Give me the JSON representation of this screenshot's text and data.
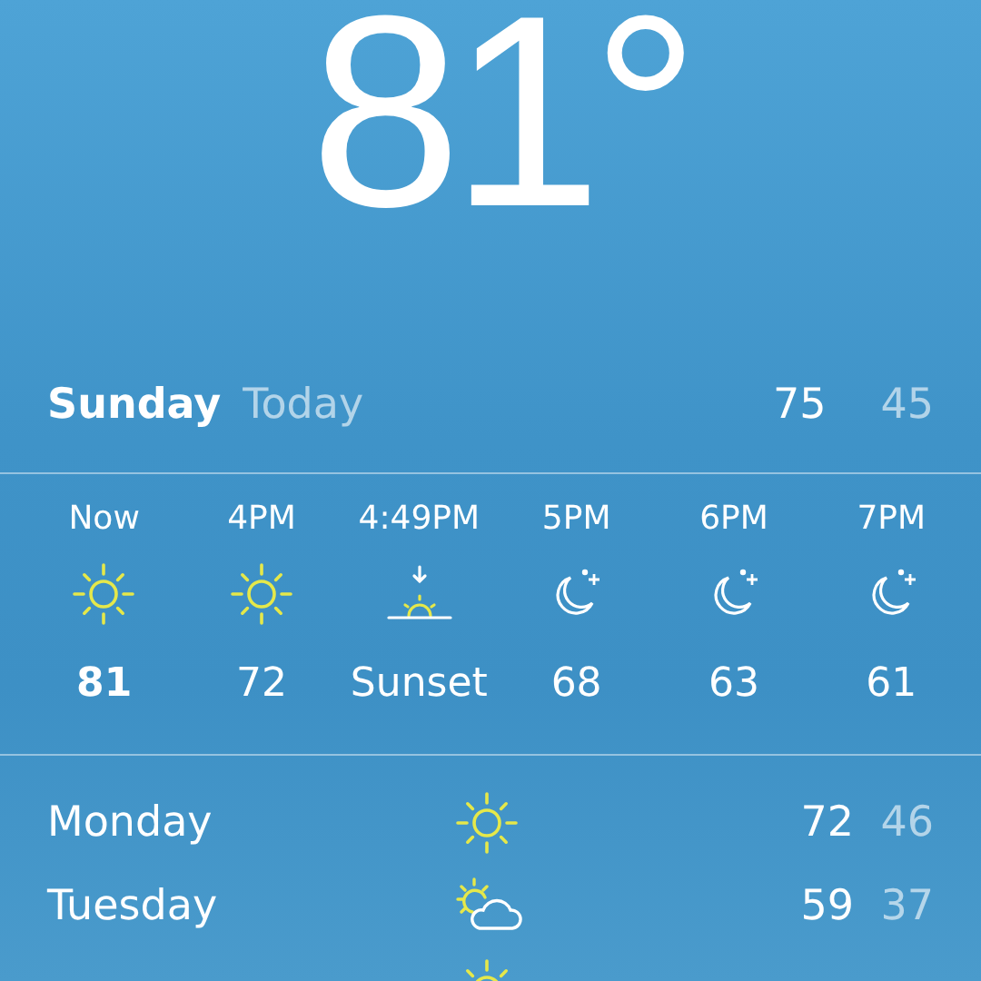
{
  "current": {
    "temperature": "81°"
  },
  "today": {
    "day": "Sunday",
    "label": "Today",
    "high": "75",
    "low": "45"
  },
  "hourly": [
    {
      "time": "Now",
      "kind": "sun",
      "value": "81",
      "current": true
    },
    {
      "time": "4PM",
      "kind": "sun",
      "value": "72",
      "current": false
    },
    {
      "time": "4:49PM",
      "kind": "sunset",
      "value": "Sunset",
      "current": false
    },
    {
      "time": "5PM",
      "kind": "moon",
      "value": "68",
      "current": false
    },
    {
      "time": "6PM",
      "kind": "moon",
      "value": "63",
      "current": false
    },
    {
      "time": "7PM",
      "kind": "moon",
      "value": "61",
      "current": false
    }
  ],
  "daily": [
    {
      "day": "Monday",
      "kind": "sun",
      "high": "72",
      "low": "46"
    },
    {
      "day": "Tuesday",
      "kind": "partly-cloudy",
      "high": "59",
      "low": "37"
    },
    {
      "kind": "sun"
    }
  ]
}
